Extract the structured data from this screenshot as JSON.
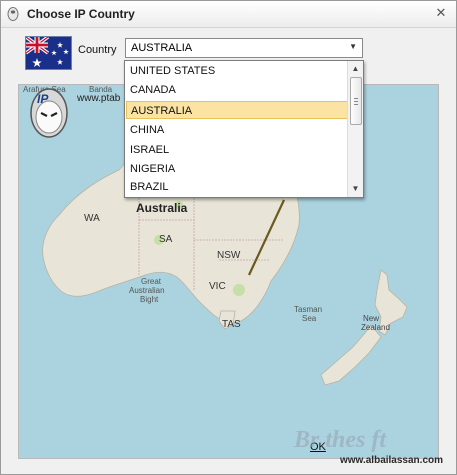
{
  "window": {
    "title": "Choose IP Country"
  },
  "form": {
    "country_label": "Country",
    "selected_country": "AUSTRALIA"
  },
  "dropdown": {
    "options": [
      "UNITED STATES",
      "CANADA",
      "AUSTRALIA",
      "CHINA",
      "ISRAEL",
      "NIGERIA",
      "BRAZIL"
    ],
    "selected_index": 2
  },
  "map": {
    "logo_text": "IP",
    "logo_overlay_text": "www.ptab",
    "sea_label": "Arafura Sea",
    "sea_label_short": "Banda",
    "country_label": "Australia",
    "regions": [
      "WA",
      "SA",
      "NSW",
      "VIC",
      "TAS"
    ],
    "bight_label": [
      "Great",
      "Australian",
      "Bight"
    ],
    "tasman_label": [
      "Tasman",
      "Sea"
    ],
    "nz_label": [
      "New",
      "Zealand"
    ],
    "selected_country_color": "#e2a020"
  },
  "buttons": {
    "ok_prefix": "",
    "ok_underlined": "OK"
  },
  "watermark": {
    "line1": "Br thes  ft",
    "line2": "www.albailassan.com"
  },
  "colors": {
    "sea": "#aad3df",
    "land": "#e8e4d7",
    "selection_bg": "#fbe4a3",
    "flag_blue": "#1a2f8a"
  }
}
